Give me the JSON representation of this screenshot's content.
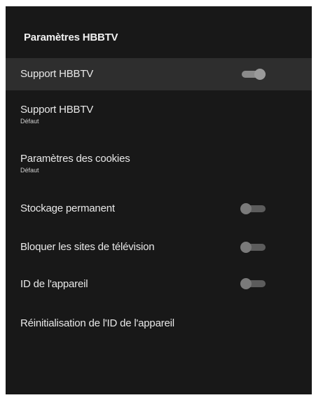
{
  "panel": {
    "title": "Paramètres HBBTV",
    "background": "#181818",
    "focus_color": "#2e2e2e"
  },
  "items": [
    {
      "label": "Support HBBTV",
      "type": "toggle",
      "toggle_state": "on",
      "focused": true
    },
    {
      "label": "Support HBBTV",
      "type": "option",
      "value": "Défaut"
    },
    {
      "label": "Paramètres des cookies",
      "type": "option",
      "value": "Défaut"
    },
    {
      "label": "Stockage permanent",
      "type": "toggle",
      "toggle_state": "off"
    },
    {
      "label": "Bloquer les sites de télévision",
      "type": "toggle",
      "toggle_state": "off"
    },
    {
      "label": "ID de l'appareil",
      "type": "toggle",
      "toggle_state": "off"
    },
    {
      "label": "Réinitialisation de l'ID de l'appareil",
      "type": "action"
    }
  ]
}
